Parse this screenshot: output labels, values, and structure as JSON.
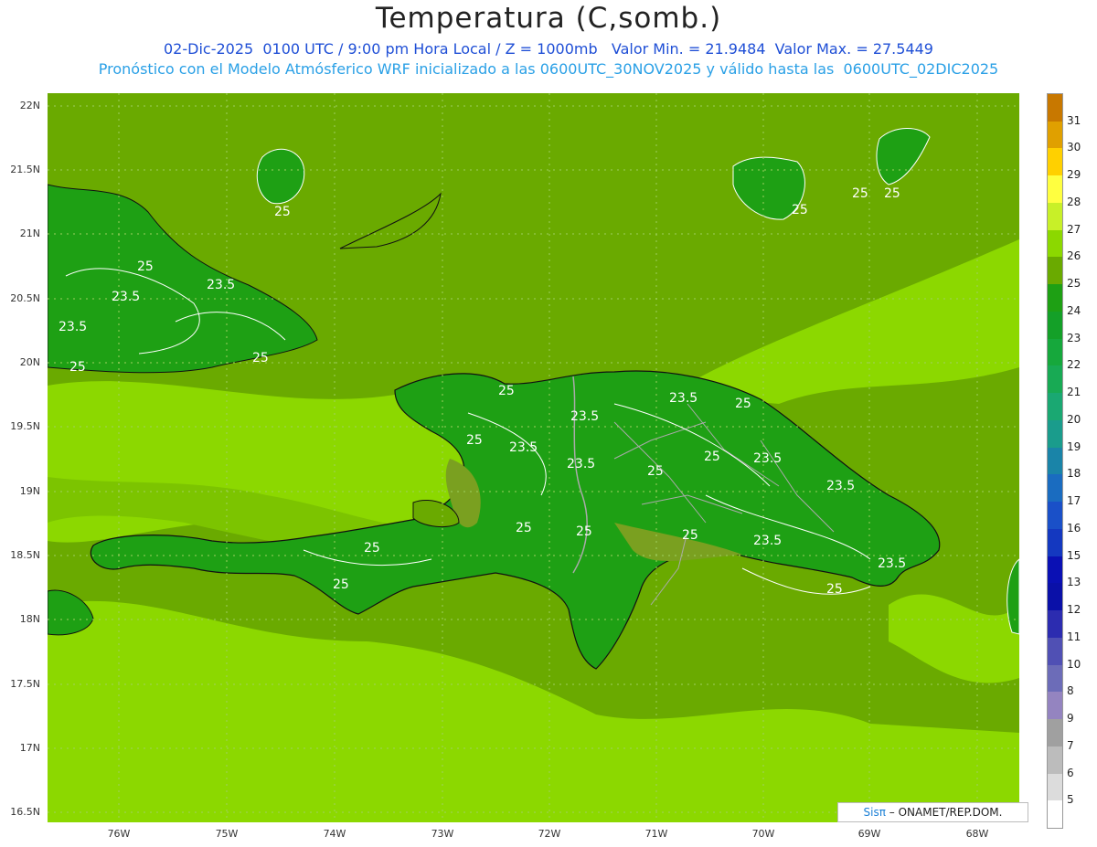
{
  "header": {
    "title": "Temperatura (C,somb.)",
    "subtitle1": "02-Dic-2025  0100 UTC / 9:00 pm Hora Local / Z = 1000mb   Valor Min. = 21.9484  Valor Max. = 27.5449",
    "subtitle2": "Pronóstico con el Modelo Atmósferico WRF inicializado a las 0600UTC_30NOV2025 y válido hasta las  0600UTC_02DIC2025"
  },
  "axes": {
    "y_labels": [
      "22N",
      "21.5N",
      "21N",
      "20.5N",
      "20N",
      "19.5N",
      "19N",
      "18.5N",
      "18N",
      "17.5N",
      "17N",
      "16.5N"
    ],
    "x_labels": [
      "76W",
      "75W",
      "74W",
      "73W",
      "72W",
      "71W",
      "70W",
      "69W",
      "68W"
    ]
  },
  "colorbar": {
    "labels": [
      "31",
      "30",
      "29",
      "28",
      "27",
      "26",
      "25",
      "24",
      "23",
      "22",
      "21",
      "20",
      "19",
      "18",
      "17",
      "16",
      "15",
      "13",
      "12",
      "11",
      "10",
      "8",
      "9",
      "7",
      "6",
      "5"
    ],
    "colors": [
      "#c87800",
      "#e0a000",
      "#ffd000",
      "#ffff40",
      "#c8f028",
      "#8cd800",
      "#6aaa00",
      "#1ea014",
      "#14a028",
      "#16a83c",
      "#18aa54",
      "#1aa872",
      "#1a9c8c",
      "#1a84a8",
      "#1a6cc0",
      "#1a50c8",
      "#1438c0",
      "#0a10b4",
      "#0a10a8",
      "#2c2cb0",
      "#5050b4",
      "#6c6cb8",
      "#9484c0",
      "#a0a0a0",
      "#bcbcbc",
      "#dcdcdc",
      "#ffffff"
    ]
  },
  "contours": [
    "25",
    "23.5",
    "25",
    "23.5",
    "23.5",
    "25",
    "25",
    "25",
    "25",
    "25",
    "25",
    "23.5",
    "25",
    "23.5",
    "25",
    "23.5",
    "23.5",
    "25",
    "25",
    "23.5",
    "23.5",
    "25",
    "25",
    "25",
    "23.5",
    "25",
    "23.5",
    "25",
    "25"
  ],
  "credit": {
    "brand": "Sisπ",
    "text": "– ONAMET/REP.DOM."
  }
}
